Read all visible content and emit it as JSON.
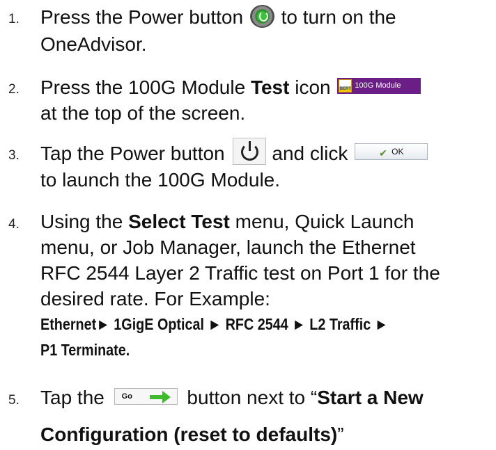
{
  "steps": [
    {
      "number": "1.",
      "line1_a": "Press the Power button",
      "line1_b": "to turn on the",
      "line2": "OneAdvisor."
    },
    {
      "number": "2.",
      "line1_a": "Press the 100G Module ",
      "line1_bold": "Test",
      "line1_b": " icon",
      "badge_small": "BERT",
      "badge_label": "100G Module",
      "line2": "at the top of the screen."
    },
    {
      "number": "3.",
      "line1_a": "Tap the Power button",
      "line1_b": "and click",
      "ok_label": "OK",
      "line2": "to launch the 100G Module."
    },
    {
      "number": "4.",
      "line1_a": "Using the ",
      "line1_bold": "Select Test",
      "line1_b": " menu, Quick Launch",
      "line2": "menu, or Job Manager, launch the Ethernet",
      "line3": "RFC 2544 Layer 2 Traffic test on Port 1 for the",
      "line4": "desired rate.  For Example:",
      "path1": "Ethernet► 1GigE Optical ► RFC 2544 ► L2 Traffic ►",
      "path2": "P1 Terminate."
    },
    {
      "number": "5.",
      "line1_a": "Tap the",
      "go_label": "Go",
      "line1_b": "button next to “",
      "line1_bold": "Start a New",
      "line2_bold": "Configuration (reset to defaults)",
      "line2_end": "”"
    }
  ],
  "colors": {
    "module_badge": "#6b1f86",
    "power_icon": "#3cc23c",
    "go_arrow": "#3fba2c"
  },
  "icons": [
    "power-icon",
    "bert-module-icon",
    "power-symbol-icon",
    "checkmark-icon",
    "arrow-right-icon"
  ]
}
